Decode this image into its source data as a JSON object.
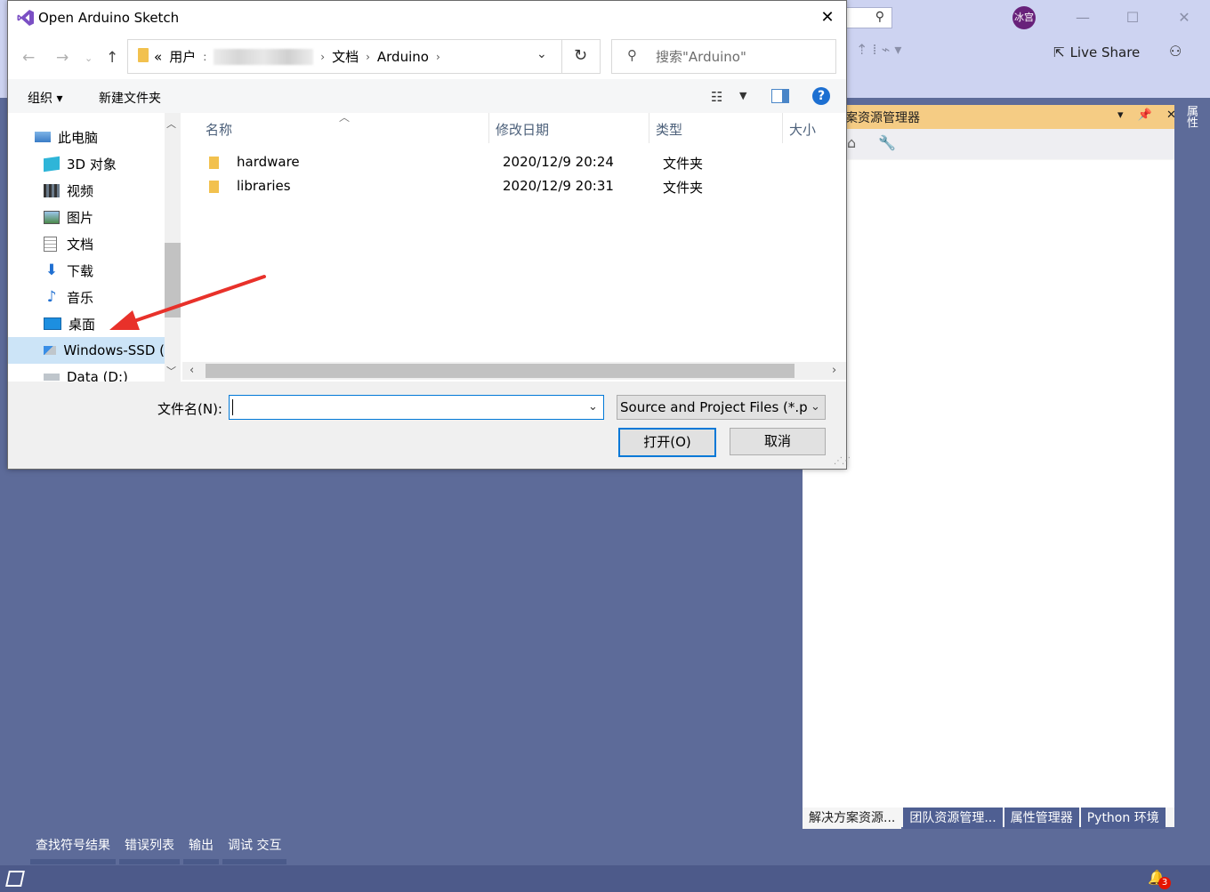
{
  "vs": {
    "avatar_text": "冰宫",
    "live_share_label": "Live Share",
    "window_min": "—",
    "window_max": "☐",
    "window_close": "✕",
    "solution_explorer_title": "案资源管理器",
    "properties_vertical": "属性",
    "panel_tabs": [
      "解决方案资源...",
      "团队资源管理...",
      "属性管理器",
      "Python 环境"
    ],
    "bottom_tabs": [
      "查找符号结果",
      "错误列表",
      "输出",
      "调试 交互"
    ],
    "notification_count": "3",
    "colors": {
      "background": "#5d6b99",
      "title": "#cdd3f1",
      "panel_header": "#f5cc84",
      "accent": "#68217a"
    }
  },
  "dialog": {
    "title": "Open Arduino Sketch",
    "close": "✕",
    "address": {
      "overflow": "«",
      "crumbs": [
        "用户",
        "文档",
        "Arduino"
      ],
      "sep": "›"
    },
    "search_placeholder": "搜索\"Arduino\"",
    "toolbar": {
      "organize": "组织 ▾",
      "new_folder": "新建文件夹"
    },
    "tree": [
      {
        "label": "此电脑",
        "icon": "pc-icon"
      },
      {
        "label": "3D 对象",
        "icon": "3d-objects-icon"
      },
      {
        "label": "视频",
        "icon": "video-icon"
      },
      {
        "label": "图片",
        "icon": "pictures-icon"
      },
      {
        "label": "文档",
        "icon": "documents-icon"
      },
      {
        "label": "下载",
        "icon": "download-icon"
      },
      {
        "label": "音乐",
        "icon": "music-icon"
      },
      {
        "label": "桌面",
        "icon": "desktop-icon"
      },
      {
        "label": "Windows-SSD (",
        "icon": "drive-icon"
      },
      {
        "label": "Data (D:)",
        "icon": "drive-icon"
      }
    ],
    "columns": [
      "名称",
      "修改日期",
      "类型",
      "大小"
    ],
    "files": [
      {
        "name": "hardware",
        "date": "2020/12/9 20:24",
        "type": "文件夹"
      },
      {
        "name": "libraries",
        "date": "2020/12/9 20:31",
        "type": "文件夹"
      }
    ],
    "filename_label": "文件名(N):",
    "filename_value": "",
    "filetype_value": "Source and Project Files (*.pde",
    "open_label": "打开(O)",
    "cancel_label": "取消"
  }
}
